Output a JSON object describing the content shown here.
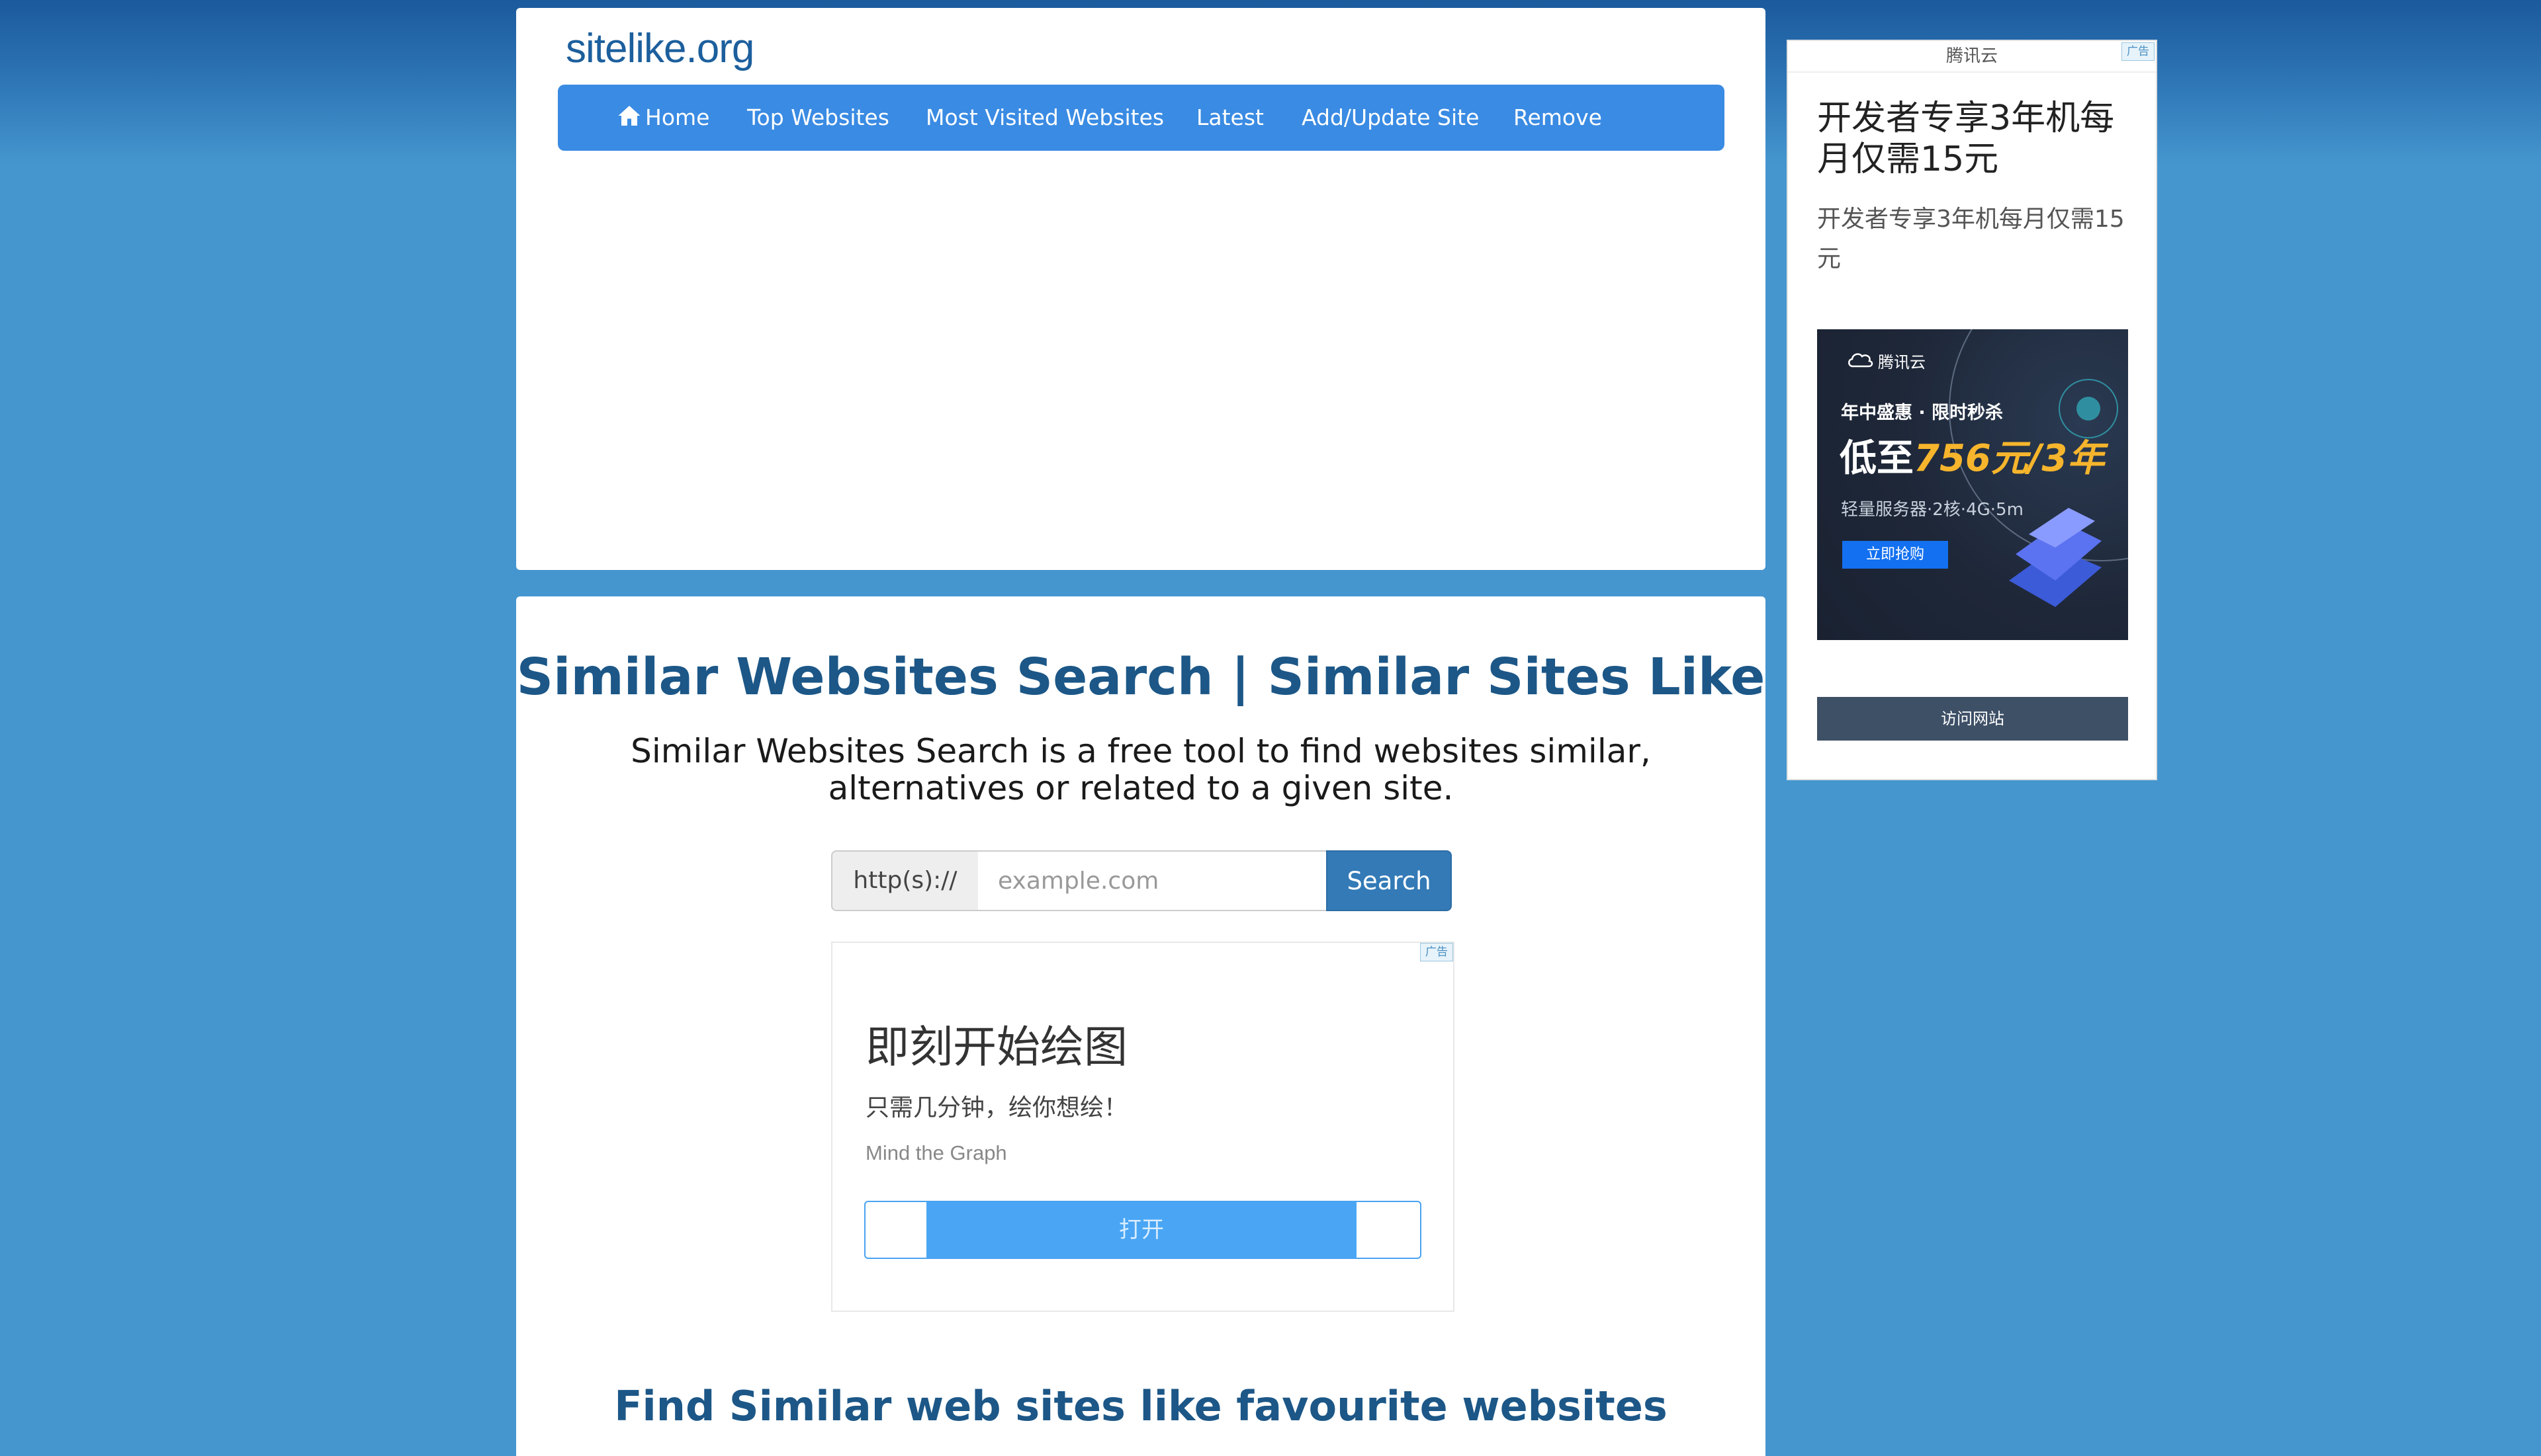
{
  "site": {
    "logo": "sitelike.org"
  },
  "nav": {
    "items": [
      {
        "label": "Home",
        "icon": "home-icon"
      },
      {
        "label": "Top Websites"
      },
      {
        "label": "Most Visited Websites"
      },
      {
        "label": "Latest"
      },
      {
        "label": "Add/Update Site"
      },
      {
        "label": "Remove"
      }
    ]
  },
  "hero": {
    "title": "Similar Websites Search | Similar Sites Like",
    "description": "Similar Websites Search is a free tool to find websites similar, alternatives or related to a given site."
  },
  "search": {
    "prefix": "http(s)://",
    "placeholder": "example.com",
    "value": "",
    "button_label": "Search"
  },
  "mid_ad": {
    "badge": "广告",
    "title": "即刻开始绘图",
    "subtitle": "只需几分钟，绘你想绘！",
    "brand": "Mind the Graph",
    "button_label": "打开"
  },
  "section": {
    "title": "Find Similar web sites like favourite websites"
  },
  "side_ad": {
    "header": "腾讯云",
    "badge": "广告",
    "title": "开发者专享3年机每月仅需15元",
    "description": "开发者专享3年机每月仅需15元",
    "image": {
      "brand": "腾讯云",
      "line1": "年中盛惠 · 限时秒杀",
      "line2_prefix": "低至",
      "line2_highlight": "756元/3年",
      "line3": "轻量服务器·2核·4G·5m",
      "button": "立即抢购"
    },
    "visit_label": "访问网站"
  },
  "colors": {
    "brand_blue": "#1c5787",
    "nav_blue": "#3a8be3",
    "button_blue": "#337ab7",
    "background": "#4596cf",
    "promo_gold": "#f6b52c"
  }
}
